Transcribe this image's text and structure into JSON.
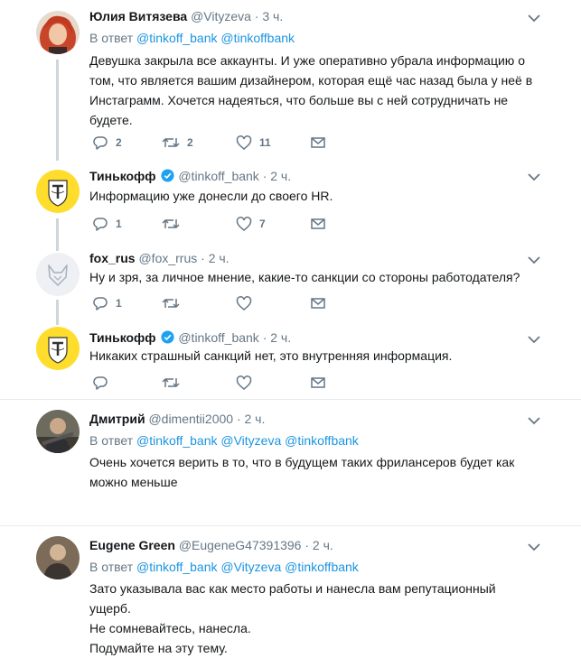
{
  "tweets": [
    {
      "name": "Юлия Витязева",
      "handle": "@Vityzeva",
      "time": "· 3 ч.",
      "reply_prefix": "В ответ",
      "reply_mentions": "@tinkoff_bank @tinkoffbank",
      "lines": [
        "Девушка закрыла все аккаунты. И уже оперативно убрала информацию о",
        "том, что является вашим дизайнером, которая ещё час назад была у неё в",
        "Инстаграмм. Хочется надеяться, что больше вы с ней сотрудничать не",
        "будете."
      ],
      "replies": "2",
      "retweets": "2",
      "likes": "11"
    },
    {
      "name": "Тинькофф",
      "handle": "@tinkoff_bank",
      "time": "· 2 ч.",
      "lines": [
        "Информацию уже донесли до своего HR."
      ],
      "replies": "1",
      "retweets": "",
      "likes": "7"
    },
    {
      "name": "fox_rus",
      "handle": "@fox_rrus",
      "time": "· 2 ч.",
      "lines": [
        "Ну и зря, за личное мнение, какие-то санкции со стороны работодателя?"
      ],
      "replies": "1",
      "retweets": "",
      "likes": ""
    },
    {
      "name": "Тинькофф",
      "handle": "@tinkoff_bank",
      "time": "· 2 ч.",
      "lines": [
        "Никаких страшный санкций нет, это внутренняя информация."
      ],
      "replies": "",
      "retweets": "",
      "likes": ""
    },
    {
      "name": "Дмитрий",
      "handle": "@dimentii2000",
      "time": "· 2 ч.",
      "reply_prefix": "В ответ",
      "reply_mentions": "@tinkoff_bank @Vityzeva @tinkoffbank",
      "lines": [
        "Очень хочется верить в то, что в будущем таких фрилансеров будет как",
        "можно меньше"
      ],
      "replies": "",
      "retweets": "",
      "likes": ""
    },
    {
      "name": "Eugene Green",
      "handle": "@EugeneG47391396",
      "time": "· 2 ч.",
      "reply_prefix": "В ответ",
      "reply_mentions": "@tinkoff_bank @Vityzeva @tinkoffbank",
      "lines": [
        "Зато указывала вас как место работы и нанесла вам репутационный ущерб.",
        "Не сомневайтесь, нанесла.",
        "Подумайте на эту тему."
      ]
    }
  ],
  "colors": {
    "text": "#14171a",
    "muted": "#657786",
    "link": "#1b95e0",
    "verified": "#1da1f2",
    "thread": "#ccd6dd",
    "divider": "#e6ecf0",
    "tinkoff_yellow": "#ffdd2d"
  },
  "icons": [
    "reply-icon",
    "retweet-icon",
    "like-icon",
    "dm-icon",
    "chevron-down-icon",
    "verified-badge-icon"
  ]
}
